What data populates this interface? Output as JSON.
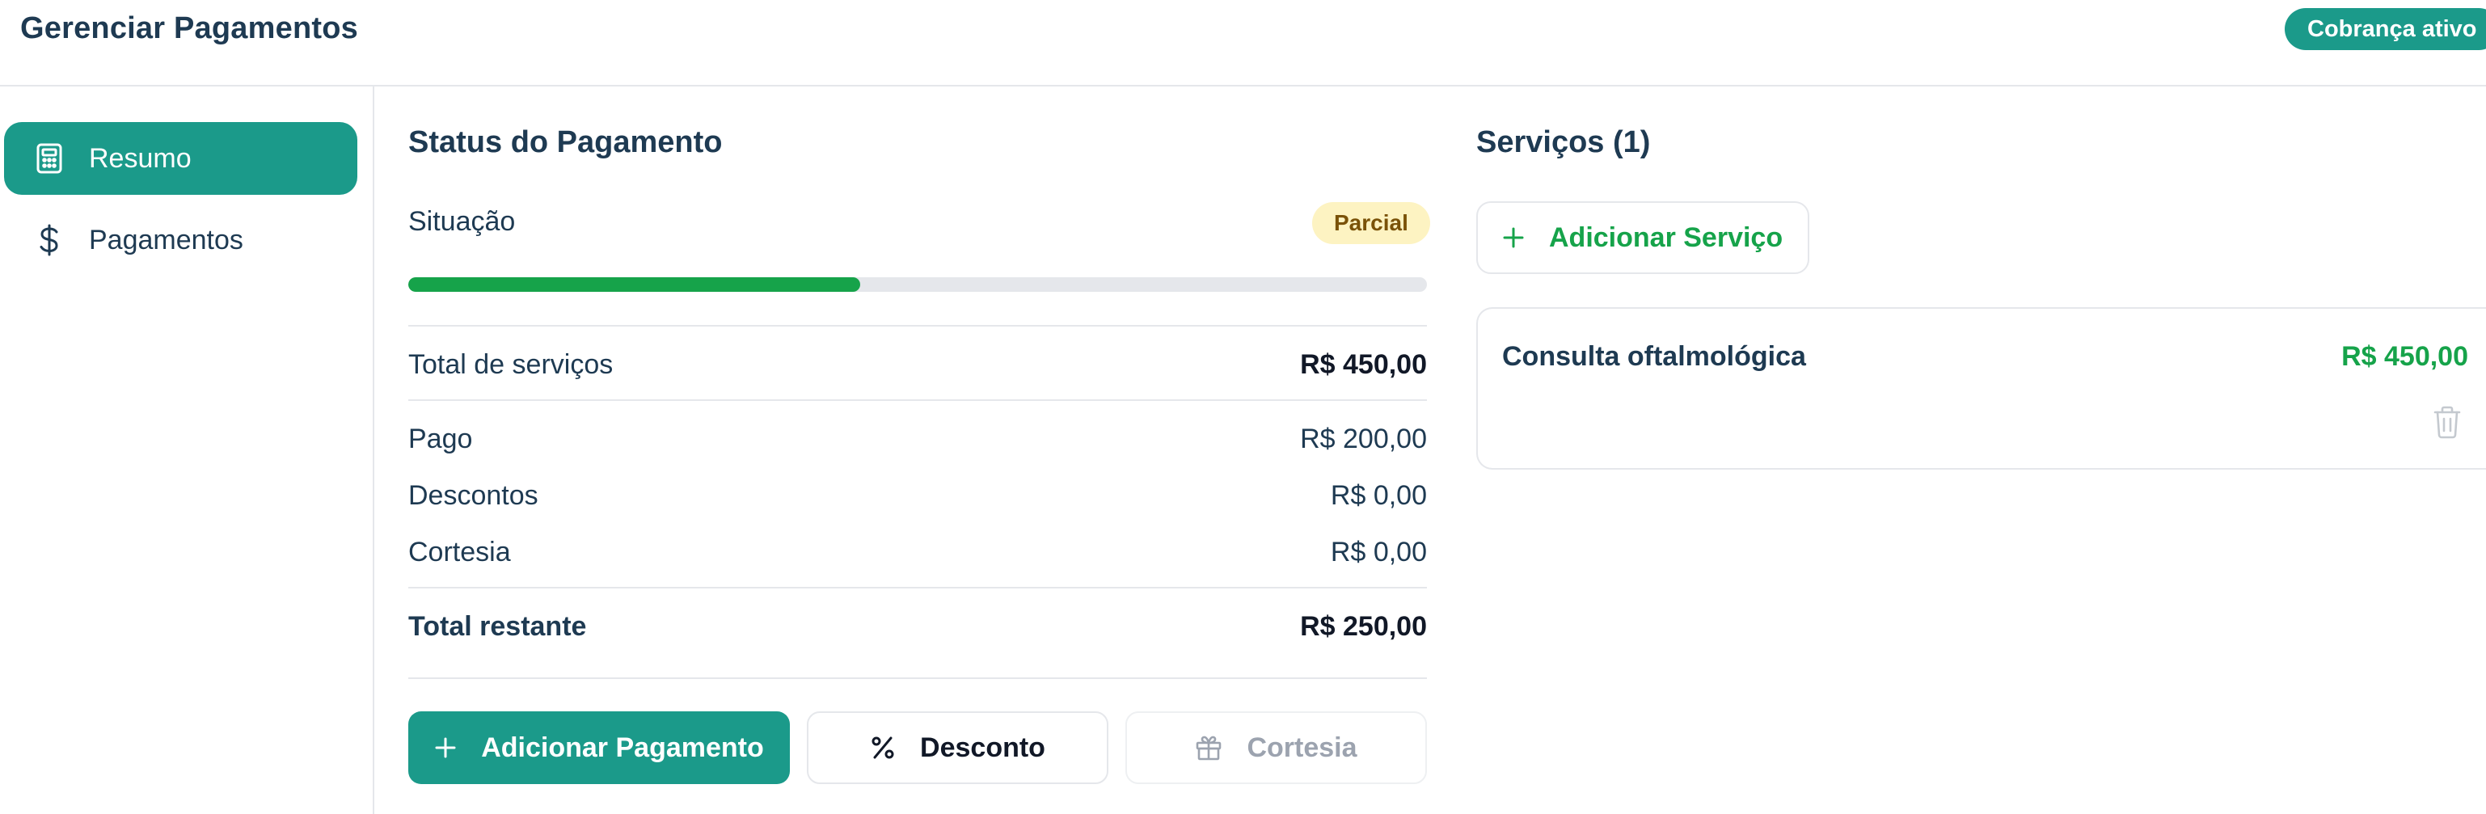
{
  "header": {
    "title": "Gerenciar Pagamentos",
    "status": "Cobrança ativo"
  },
  "sidebar": {
    "items": [
      {
        "label": "Resumo",
        "icon": "calculator-icon",
        "active": true
      },
      {
        "label": "Pagamentos",
        "icon": "dollar-icon",
        "active": false
      }
    ]
  },
  "payment_status": {
    "title": "Status do Pagamento",
    "situation_label": "Situação",
    "situation_badge": "Parcial",
    "progress_fraction": 0.444,
    "rows": [
      {
        "label": "Total de serviços",
        "value": "R$ 450,00"
      },
      {
        "label": "Pago",
        "value": "R$ 200,00"
      },
      {
        "label": "Descontos",
        "value": "R$ 0,00"
      },
      {
        "label": "Cortesia",
        "value": "R$ 0,00"
      },
      {
        "label": "Total restante",
        "value": "R$ 250,00"
      }
    ],
    "buttons": {
      "add_payment": "Adicionar Pagamento",
      "discount": "Desconto",
      "courtesy": "Cortesia"
    }
  },
  "services": {
    "title": "Serviços (1)",
    "add_button": "Adicionar Serviço",
    "items": [
      {
        "name": "Consulta oftalmológica",
        "price": "R$ 450,00"
      }
    ]
  },
  "colors": {
    "primary": "#1b9a8a",
    "success": "#16a34a",
    "badge_bg": "#fdf3c2",
    "badge_text": "#7a5208",
    "text": "#1e3a52"
  }
}
